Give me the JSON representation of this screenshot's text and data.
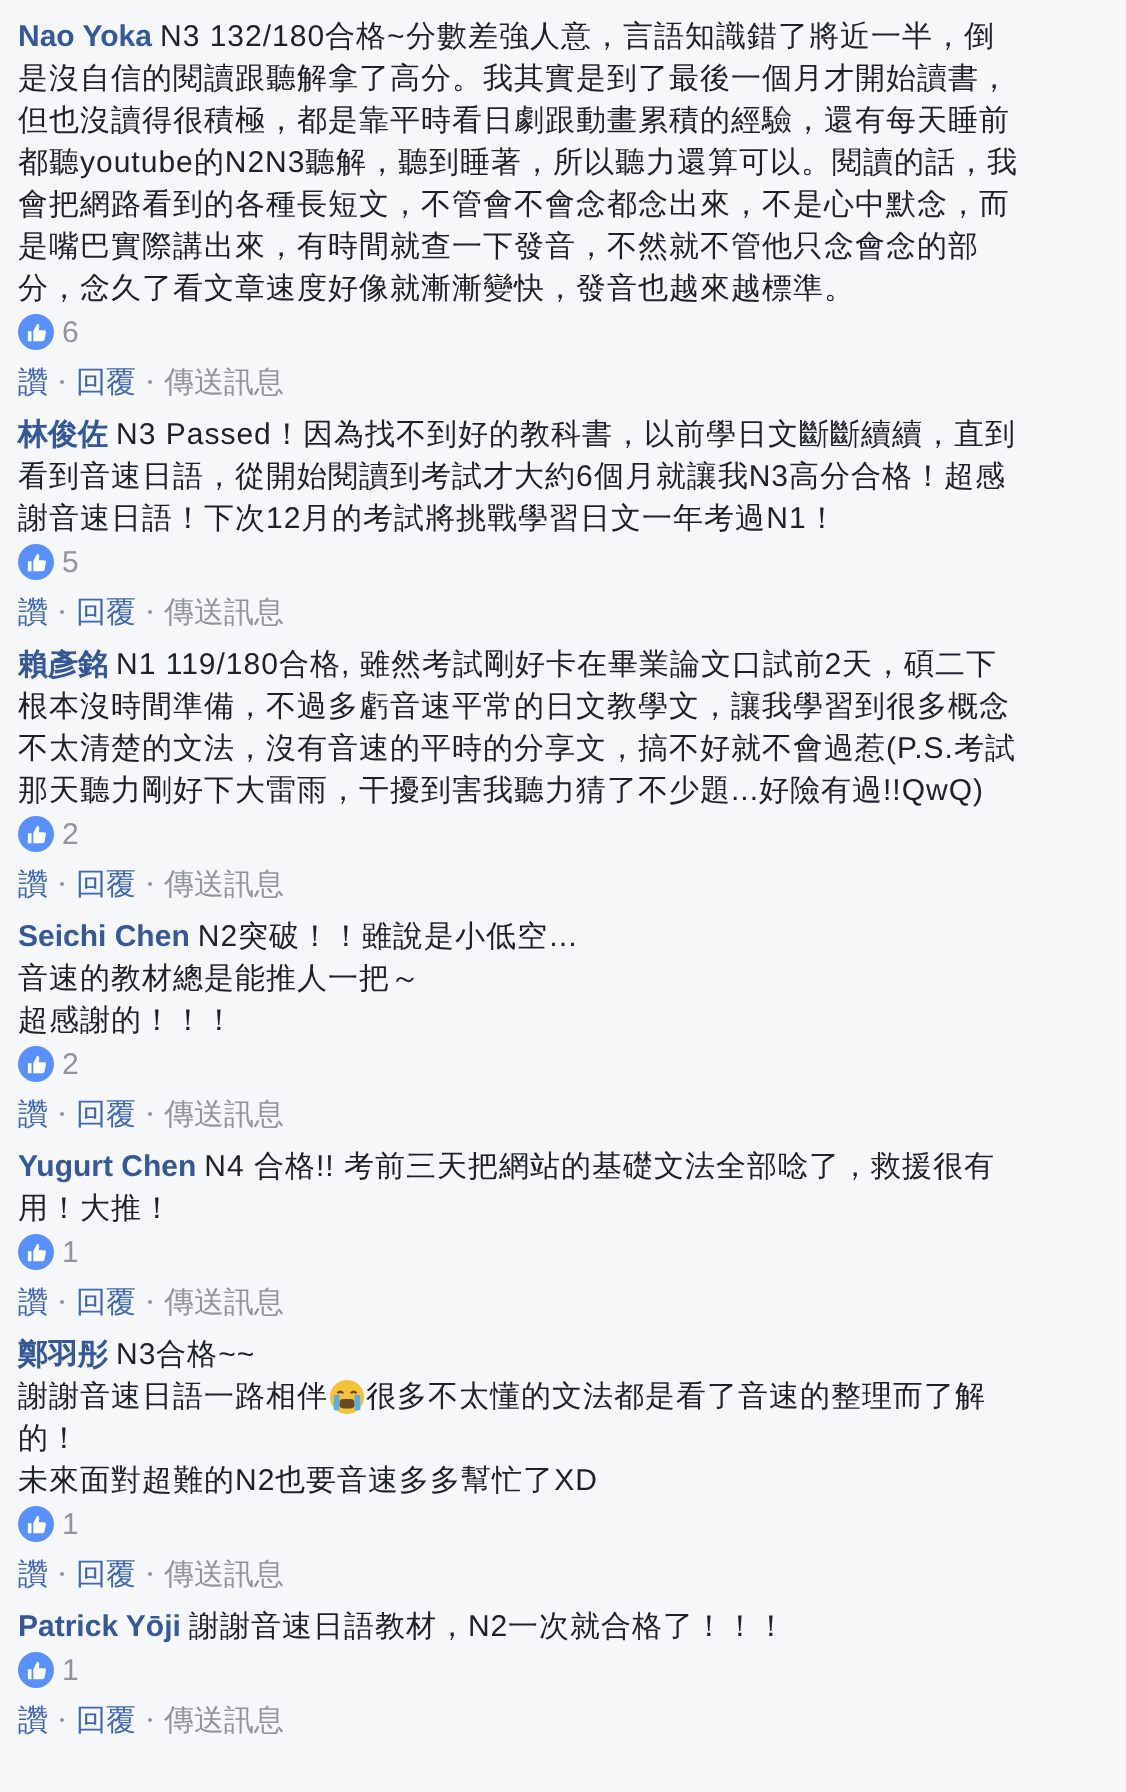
{
  "comments": [
    {
      "author": "Nao Yoka",
      "lines": [
        [
          {
            "kind": "text",
            "text": "N3 132/180合格~分數差強人意，言語知識錯了將近一半，倒"
          }
        ],
        [
          {
            "kind": "text",
            "text": "是沒自信的閱讀跟聽解拿了高分。我其實是到了最後一個月才開始讀書，"
          }
        ],
        [
          {
            "kind": "text",
            "text": "但也沒讀得很積極，都是靠平時看日劇跟動畫累積的經驗，還有每天睡前"
          }
        ],
        [
          {
            "kind": "text",
            "text": "都聽youtube的N2N3聽解，聽到睡著，所以聽力還算可以。閱讀的話，我"
          }
        ],
        [
          {
            "kind": "text",
            "text": "會把網路看到的各種長短文，不管會不會念都念出來，不是心中默念，而"
          }
        ],
        [
          {
            "kind": "text",
            "text": "是嘴巴實際講出來，有時間就查一下發音，不然就不管他只念會念的部"
          }
        ],
        [
          {
            "kind": "text",
            "text": "分，念久了看文章速度好像就漸漸變快，發音也越來越標準。"
          }
        ]
      ],
      "likes": "6",
      "actions": [
        {
          "kind": "link",
          "label": "讚"
        },
        {
          "kind": "link",
          "label": "回覆"
        },
        {
          "kind": "muted",
          "label": "傳送訊息"
        }
      ]
    },
    {
      "author": "林俊佐",
      "lines": [
        [
          {
            "kind": "text",
            "text": "N3 Passed！因為找不到好的教科書，以前學日文斷斷續續，直到"
          }
        ],
        [
          {
            "kind": "text",
            "text": "看到音速日語，從開始閱讀到考試才大約6個月就讓我N3高分合格！超感"
          }
        ],
        [
          {
            "kind": "text",
            "text": "謝音速日語！下次12月的考試將挑戰學習日文一年考過N1！"
          }
        ]
      ],
      "likes": "5",
      "actions": [
        {
          "kind": "link",
          "label": "讚"
        },
        {
          "kind": "link",
          "label": "回覆"
        },
        {
          "kind": "muted",
          "label": "傳送訊息"
        }
      ]
    },
    {
      "author": "賴彥銘",
      "lines": [
        [
          {
            "kind": "text",
            "text": "N1 119/180合格, 雖然考試剛好卡在畢業論文口試前2天，碩二下"
          }
        ],
        [
          {
            "kind": "text",
            "text": "根本沒時間準備，不過多虧音速平常的日文教學文，讓我學習到很多概念"
          }
        ],
        [
          {
            "kind": "text",
            "text": "不太清楚的文法，沒有音速的平時的分享文，搞不好就不會過惹(P.S.考試"
          }
        ],
        [
          {
            "kind": "text",
            "text": "那天聽力剛好下大雷雨，干擾到害我聽力猜了不少題...好險有過!!QwQ)"
          }
        ]
      ],
      "likes": "2",
      "actions": [
        {
          "kind": "link",
          "label": "讚"
        },
        {
          "kind": "link",
          "label": "回覆"
        },
        {
          "kind": "muted",
          "label": "傳送訊息"
        }
      ]
    },
    {
      "author": "Seichi Chen",
      "lines": [
        [
          {
            "kind": "text",
            "text": "N2突破！！雖說是小低空…"
          }
        ],
        [
          {
            "kind": "text",
            "text": "音速的教材總是能推人一把～"
          }
        ],
        [
          {
            "kind": "text",
            "text": "超感謝的！！！"
          }
        ]
      ],
      "likes": "2",
      "actions": [
        {
          "kind": "link",
          "label": "讚"
        },
        {
          "kind": "link",
          "label": "回覆"
        },
        {
          "kind": "muted",
          "label": "傳送訊息"
        }
      ]
    },
    {
      "author": "Yugurt Chen",
      "lines": [
        [
          {
            "kind": "text",
            "text": "N4 合格!! 考前三天把網站的基礎文法全部唸了，救援很有"
          }
        ],
        [
          {
            "kind": "text",
            "text": "用！大推！"
          }
        ]
      ],
      "likes": "1",
      "actions": [
        {
          "kind": "link",
          "label": "讚"
        },
        {
          "kind": "link",
          "label": "回覆"
        },
        {
          "kind": "muted",
          "label": "傳送訊息"
        }
      ]
    },
    {
      "author": "鄭羽彤",
      "lines": [
        [
          {
            "kind": "text",
            "text": "N3合格~~"
          }
        ],
        [
          {
            "kind": "text",
            "text": "謝謝音速日語一路相伴"
          },
          {
            "kind": "emoji"
          },
          {
            "kind": "text",
            "text": "很多不太懂的文法都是看了音速的整理而了解"
          }
        ],
        [
          {
            "kind": "text",
            "text": "的！"
          }
        ],
        [
          {
            "kind": "text",
            "text": "未來面對超難的N2也要音速多多幫忙了XD"
          }
        ]
      ],
      "likes": "1",
      "actions": [
        {
          "kind": "link",
          "label": "讚"
        },
        {
          "kind": "link",
          "label": "回覆"
        },
        {
          "kind": "muted",
          "label": "傳送訊息"
        }
      ]
    },
    {
      "author": "Patrick Yōji",
      "lines": [
        [
          {
            "kind": "text",
            "text": "謝謝音速日語教材，N2一次就合格了！！！"
          }
        ]
      ],
      "likes": "1",
      "actions": [
        {
          "kind": "link",
          "label": "讚"
        },
        {
          "kind": "link",
          "label": "回覆"
        },
        {
          "kind": "muted",
          "label": "傳送訊息"
        }
      ]
    }
  ]
}
